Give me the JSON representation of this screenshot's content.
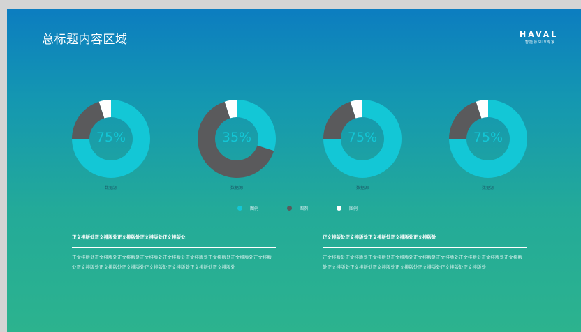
{
  "header": {
    "title": "总标题内容区域",
    "logo": {
      "word": "HAVAL",
      "subtitle": "智能源SUV专家"
    }
  },
  "colors": {
    "primary": "#13c7d6",
    "secondary": "#5a5a5c",
    "tertiary": "#ffffff"
  },
  "charts": [
    {
      "percent_label": "75%",
      "shares": [
        0.75,
        0.2,
        0.05
      ],
      "caption": "数据源"
    },
    {
      "percent_label": "35%",
      "shares": [
        0.3,
        0.65,
        0.05
      ],
      "caption": "数据源"
    },
    {
      "percent_label": "75%",
      "shares": [
        0.75,
        0.2,
        0.05
      ],
      "caption": "数据源"
    },
    {
      "percent_label": "75%",
      "shares": [
        0.75,
        0.2,
        0.05
      ],
      "caption": "数据源"
    }
  ],
  "legend": [
    {
      "label": "图例",
      "color": "#13c7d6"
    },
    {
      "label": "图例",
      "color": "#5a5a5c"
    },
    {
      "label": "图例",
      "color": "#ffffff"
    }
  ],
  "text_blocks": [
    {
      "heading": "正文排版处正文排版处正文排版处正文排版处正文排版处",
      "body": "正文排版处正文排版处正文排版处正文排版处正文排版处正文排版处正文排版处正文排版处正文排版处正文排版处正文排版处正文排版处正文排版处正文排版处正文排版处正文排版处"
    },
    {
      "heading": "正文排版处正文排版处正文排版处正文排版处正文排版处",
      "body": "正文排版处正文排版处正文排版处正文排版处正文排版处正文排版处正文排版处正文排版处正文排版处正文排版处正文排版处正文排版处正文排版处正文排版处正文排版处正文排版处"
    }
  ]
}
